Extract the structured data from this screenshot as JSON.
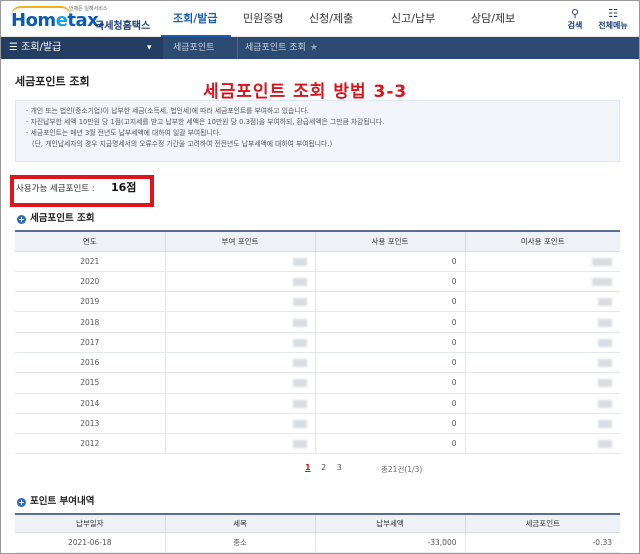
{
  "header": {
    "logo_sub": "언제든 일해서비스",
    "logo_main_a": "Hom",
    "logo_main_e": "e",
    "logo_main_b": "tax.",
    "logo_kr": "국세청홈택스",
    "nav": [
      "조회/발급",
      "민원증명",
      "신청/제출",
      "신고/납부",
      "상담/제보"
    ],
    "active_index": 0,
    "search_label": "검색",
    "menu_label": "전체메뉴"
  },
  "subbar": {
    "menu_label": "조회/발급",
    "crumb_1": "세금포인트",
    "crumb_2": "세금포인트 조회"
  },
  "page": {
    "title": "세금포인트 조회",
    "overlay_title": "세금포인트 조회 방법 3-3"
  },
  "info": [
    "개인 또는 법인(중소기업)이 납부한 세금(소득세, 법인세)에 따라 세금포인트를 부여하고 있습니다.",
    "자진납부한 세액 10만원 당 1점(고지세를 받고 납부한 세액은 10만원 당 0.3점)을 부여하되, 환급세액은 그만큼 차감됩니다.",
    "세금포인트는 매년 3월 전년도 납부세액에 대하여 일괄 부여됩니다.",
    "(단, 개인납세자의 경우 지급명세서의 오류수정 기간을 고려하여 전전년도 납부세액에 대하여 부여됩니다.)"
  ],
  "available": {
    "label": "사용가능 세금포인트 :",
    "value": "16점"
  },
  "points_section": {
    "heading": "세금포인트 조회",
    "columns": [
      "연도",
      "부여 포인트",
      "사용 포인트",
      "미사용 포인트"
    ],
    "rows": [
      {
        "year": "2021",
        "used": "0"
      },
      {
        "year": "2020",
        "used": "0"
      },
      {
        "year": "2019",
        "used": "0"
      },
      {
        "year": "2018",
        "used": "0"
      },
      {
        "year": "2017",
        "used": "0"
      },
      {
        "year": "2016",
        "used": "0"
      },
      {
        "year": "2015",
        "used": "0"
      },
      {
        "year": "2014",
        "used": "0"
      },
      {
        "year": "2013",
        "used": "0"
      },
      {
        "year": "2012",
        "used": "0"
      }
    ]
  },
  "pager": {
    "pages": [
      "1",
      "2",
      "3"
    ],
    "current": "1",
    "total": "총21건(1/3)"
  },
  "grant_section": {
    "heading": "포인트 부여내역",
    "columns": [
      "납부일자",
      "세목",
      "납부세액",
      "세금포인트"
    ],
    "rows": [
      {
        "date": "2021-06-18",
        "tax": "종소",
        "amount": "-33,000",
        "point": "-0.33"
      }
    ]
  },
  "colors": {
    "brand": "#1b5fb3",
    "subbar": "#2d4a72",
    "highlight": "#e0141c"
  },
  "icons": {
    "search": "search-icon",
    "menu": "grid-menu-icon",
    "hamburger": "hamburger-icon",
    "star": "star-icon"
  }
}
